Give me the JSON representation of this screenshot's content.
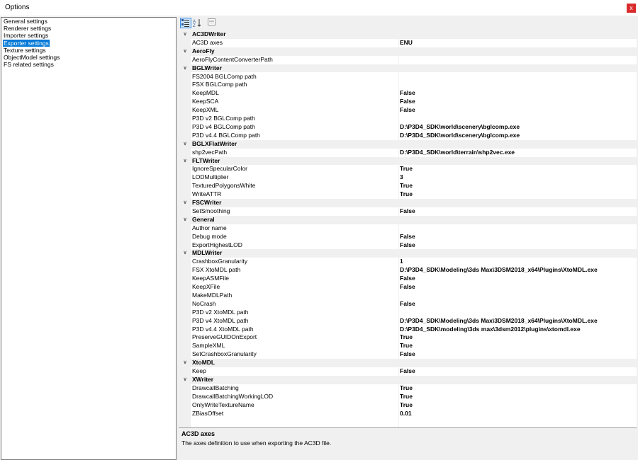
{
  "window": {
    "title": "Options",
    "close_glyph": "x"
  },
  "sidebar": {
    "items": [
      {
        "label": "General settings",
        "selected": false
      },
      {
        "label": "Renderer settings",
        "selected": false
      },
      {
        "label": "Importer settings",
        "selected": false
      },
      {
        "label": "Exporter settings",
        "selected": true
      },
      {
        "label": "Texture settings",
        "selected": false
      },
      {
        "label": "ObjectModel settings",
        "selected": false
      },
      {
        "label": "FS related settings",
        "selected": false
      }
    ]
  },
  "toolbar": {
    "buttons": [
      {
        "name": "categorized-view-icon",
        "active": true
      },
      {
        "name": "alphabetical-sort-icon",
        "active": false
      },
      {
        "name": "property-pages-icon",
        "active": false
      }
    ]
  },
  "grid": {
    "categories": [
      {
        "name": "AC3DWriter",
        "props": [
          {
            "name": "AC3D axes",
            "value": "ENU"
          }
        ]
      },
      {
        "name": "AeroFly",
        "props": [
          {
            "name": "AeroFlyContentConverterPath",
            "value": ""
          }
        ]
      },
      {
        "name": "BGLWriter",
        "props": [
          {
            "name": "FS2004 BGLComp path",
            "value": ""
          },
          {
            "name": "FSX BGLComp path",
            "value": ""
          },
          {
            "name": "KeepMDL",
            "value": "False"
          },
          {
            "name": "KeepSCA",
            "value": "False"
          },
          {
            "name": "KeepXML",
            "value": "False"
          },
          {
            "name": "P3D v2 BGLComp path",
            "value": ""
          },
          {
            "name": "P3D v4 BGLComp path",
            "value": "D:\\P3D4_SDK\\world\\scenery\\bglcomp.exe"
          },
          {
            "name": "P3D v4.4 BGLComp path",
            "value": "D:\\P3D4_SDK\\world\\scenery\\bglcomp.exe"
          }
        ]
      },
      {
        "name": "BGLXFlatWriter",
        "props": [
          {
            "name": "shp2vecPath",
            "value": "D:\\P3D4_SDK\\world\\terrain\\shp2vec.exe"
          }
        ]
      },
      {
        "name": "FLTWriter",
        "props": [
          {
            "name": "IgnoreSpecularColor",
            "value": "True"
          },
          {
            "name": "LODMultiplier",
            "value": "3"
          },
          {
            "name": "TexturedPolygonsWhite",
            "value": "True"
          },
          {
            "name": "WriteATTR",
            "value": "True"
          }
        ]
      },
      {
        "name": "FSCWriter",
        "props": [
          {
            "name": "SetSmoothing",
            "value": "False"
          }
        ]
      },
      {
        "name": "General",
        "props": [
          {
            "name": "Author name",
            "value": ""
          },
          {
            "name": "Debug mode",
            "value": "False"
          },
          {
            "name": "ExportHighestLOD",
            "value": "False"
          }
        ]
      },
      {
        "name": "MDLWriter",
        "props": [
          {
            "name": "CrashboxGranularity",
            "value": "1"
          },
          {
            "name": "FSX XtoMDL path",
            "value": "D:\\P3D4_SDK\\Modeling\\3ds Max\\3DSM2018_x64\\Plugins\\XtoMDL.exe"
          },
          {
            "name": "KeepASMFile",
            "value": "False"
          },
          {
            "name": "KeepXFile",
            "value": "False"
          },
          {
            "name": "MakeMDLPath",
            "value": ""
          },
          {
            "name": "NoCrash",
            "value": "False"
          },
          {
            "name": "P3D v2 XtoMDL path",
            "value": ""
          },
          {
            "name": "P3D v4 XtoMDL path",
            "value": "D:\\P3D4_SDK\\Modeling\\3ds Max\\3DSM2018_x64\\Plugins\\XtoMDL.exe"
          },
          {
            "name": "P3D v4.4 XtoMDL path",
            "value": "D:\\P3D4_SDK\\modeling\\3ds max\\3dsm2012\\plugins\\xtomdl.exe"
          },
          {
            "name": "PreserveGUIDOnExport",
            "value": "True"
          },
          {
            "name": "SampleXML",
            "value": "True"
          },
          {
            "name": "SetCrashboxGranularity",
            "value": "False"
          }
        ]
      },
      {
        "name": "XtoMDL",
        "props": [
          {
            "name": "Keep",
            "value": "False"
          }
        ]
      },
      {
        "name": "XWriter",
        "props": [
          {
            "name": "DrawcallBatching",
            "value": "True"
          },
          {
            "name": "DrawcallBatchingWorkingLOD",
            "value": "True"
          },
          {
            "name": "OnlyWriteTextureName",
            "value": "True"
          },
          {
            "name": "ZBiasOffset",
            "value": "0.01"
          }
        ]
      }
    ]
  },
  "description": {
    "title": "AC3D axes",
    "text": "The axes definition to use when exporting the AC3D file."
  },
  "colors": {
    "selection": "#0078d7",
    "close_button": "#d92b2b",
    "panel_bg": "#f0f0f0"
  }
}
